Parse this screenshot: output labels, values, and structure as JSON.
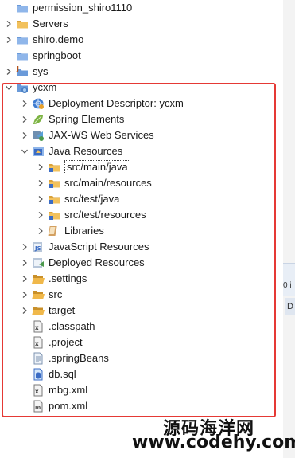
{
  "tree": [
    {
      "label": "permission_shiro1110",
      "depth": 0,
      "expanded": null,
      "icon": "project-folder-icon",
      "name": "project-permission-shiro"
    },
    {
      "label": "Servers",
      "depth": 0,
      "expanded": false,
      "icon": "folder-icon",
      "name": "project-servers"
    },
    {
      "label": "shiro.demo",
      "depth": 0,
      "expanded": false,
      "icon": "project-folder-icon",
      "name": "project-shiro-demo"
    },
    {
      "label": "springboot",
      "depth": 0,
      "expanded": null,
      "icon": "project-folder-icon",
      "name": "project-springboot"
    },
    {
      "label": "sys",
      "depth": 0,
      "expanded": false,
      "icon": "java-project-icon",
      "name": "project-sys"
    },
    {
      "label": "ycxm",
      "depth": 0,
      "expanded": true,
      "icon": "web-project-icon",
      "name": "project-ycxm"
    },
    {
      "label": "Deployment Descriptor: ycxm",
      "depth": 1,
      "expanded": false,
      "icon": "globe-icon",
      "name": "deployment-descriptor"
    },
    {
      "label": "Spring Elements",
      "depth": 1,
      "expanded": false,
      "icon": "spring-leaf-icon",
      "name": "spring-elements"
    },
    {
      "label": "JAX-WS Web Services",
      "depth": 1,
      "expanded": false,
      "icon": "web-services-icon",
      "name": "jax-ws-web-services"
    },
    {
      "label": "Java Resources",
      "depth": 1,
      "expanded": true,
      "icon": "java-resources-icon",
      "name": "java-resources"
    },
    {
      "label": "src/main/java",
      "depth": 2,
      "expanded": false,
      "icon": "source-folder-icon",
      "name": "src-main-java",
      "boxed": true
    },
    {
      "label": "src/main/resources",
      "depth": 2,
      "expanded": false,
      "icon": "source-folder-icon",
      "name": "src-main-resources"
    },
    {
      "label": "src/test/java",
      "depth": 2,
      "expanded": false,
      "icon": "source-folder-icon",
      "name": "src-test-java"
    },
    {
      "label": "src/test/resources",
      "depth": 2,
      "expanded": false,
      "icon": "source-folder-icon",
      "name": "src-test-resources"
    },
    {
      "label": "Libraries",
      "depth": 2,
      "expanded": false,
      "icon": "library-icon",
      "name": "libraries"
    },
    {
      "label": "JavaScript Resources",
      "depth": 1,
      "expanded": false,
      "icon": "javascript-resources-icon",
      "name": "javascript-resources"
    },
    {
      "label": "Deployed Resources",
      "depth": 1,
      "expanded": false,
      "icon": "deployed-resources-icon",
      "name": "deployed-resources"
    },
    {
      "label": ".settings",
      "depth": 1,
      "expanded": false,
      "icon": "open-folder-icon",
      "name": "folder-settings"
    },
    {
      "label": "src",
      "depth": 1,
      "expanded": false,
      "icon": "open-folder-icon",
      "name": "folder-src"
    },
    {
      "label": "target",
      "depth": 1,
      "expanded": false,
      "icon": "open-folder-icon",
      "name": "folder-target"
    },
    {
      "label": ".classpath",
      "depth": 1,
      "expanded": null,
      "icon": "xml-file-icon",
      "name": "file-classpath"
    },
    {
      "label": ".project",
      "depth": 1,
      "expanded": null,
      "icon": "xml-file-icon",
      "name": "file-project"
    },
    {
      "label": ".springBeans",
      "depth": 1,
      "expanded": null,
      "icon": "text-file-icon",
      "name": "file-springbeans"
    },
    {
      "label": "db.sql",
      "depth": 1,
      "expanded": null,
      "icon": "sql-file-icon",
      "name": "file-db-sql"
    },
    {
      "label": "mbg.xml",
      "depth": 1,
      "expanded": null,
      "icon": "xml-file-icon",
      "name": "file-mbg-xml"
    },
    {
      "label": "pom.xml",
      "depth": 1,
      "expanded": null,
      "icon": "maven-file-icon",
      "name": "file-pom-xml"
    }
  ],
  "side": {
    "tab_text": "0 i",
    "tab2_text": "D"
  },
  "watermark": {
    "line1": "源码海洋网",
    "line2": "www.codehy.com"
  },
  "colors": {
    "highlight_border": "#e53935",
    "folder": "#e8a33c",
    "link": "#3b6cc4"
  }
}
